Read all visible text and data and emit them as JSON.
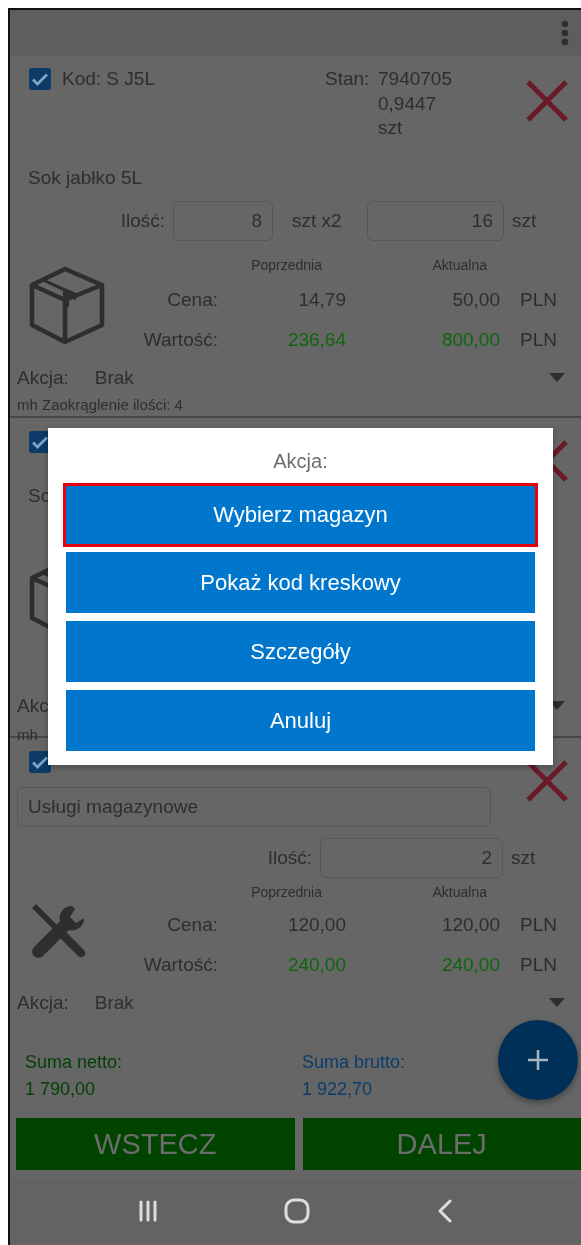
{
  "items": [
    {
      "kind": "full",
      "checked": true,
      "code": "Kod: S J5L",
      "stock_label": "Stan:",
      "stock_lines": [
        "7940705",
        "0,9447",
        "szt"
      ],
      "name": "Sok jabłko 5L",
      "quantity_label": "Ilość:",
      "quantity": "8",
      "unit_multiplier": "szt x2",
      "quantity_total": "16",
      "unit": "szt",
      "prev_header": "Poprzednia",
      "curr_header": "Aktualna",
      "price_label": "Cena:",
      "price_prev": "14,79",
      "price_curr": "50,00",
      "price_currency": "PLN",
      "value_label": "Wartość:",
      "value_prev": "236,64",
      "value_curr": "800,00",
      "value_currency": "PLN",
      "action_label": "Akcja:",
      "action_value": "Brak",
      "note": "mh Zaokrąglenie ilości: 4"
    },
    {
      "kind": "covered",
      "checked": true,
      "name": "Sc",
      "action_label": "Akc",
      "note": "mh"
    },
    {
      "kind": "service",
      "checked": true,
      "name": "Usługi magazynowe",
      "quantity_label": "Ilość:",
      "quantity": "2",
      "unit": "szt",
      "prev_header": "Poprzednia",
      "curr_header": "Aktualna",
      "price_label": "Cena:",
      "price_prev": "120,00",
      "price_curr": "120,00",
      "price_currency": "PLN",
      "value_label": "Wartość:",
      "value_prev": "240,00",
      "value_curr": "240,00",
      "value_currency": "PLN",
      "action_label": "Akcja:",
      "action_value": "Brak"
    }
  ],
  "totals": {
    "net_label": "Suma netto:",
    "net_value": "1 790,00",
    "gross_label": "Suma brutto:",
    "gross_value": "1 922,70"
  },
  "buttons": [
    "WSTECZ",
    "DALEJ"
  ],
  "dialog": {
    "title": "Akcja:",
    "options": [
      {
        "label": "Wybierz magazyn",
        "selected": true
      },
      {
        "label": "Pokaż kod kreskowy",
        "selected": false
      },
      {
        "label": "Szczegóły",
        "selected": false
      },
      {
        "label": "Anuluj",
        "selected": false
      }
    ]
  }
}
